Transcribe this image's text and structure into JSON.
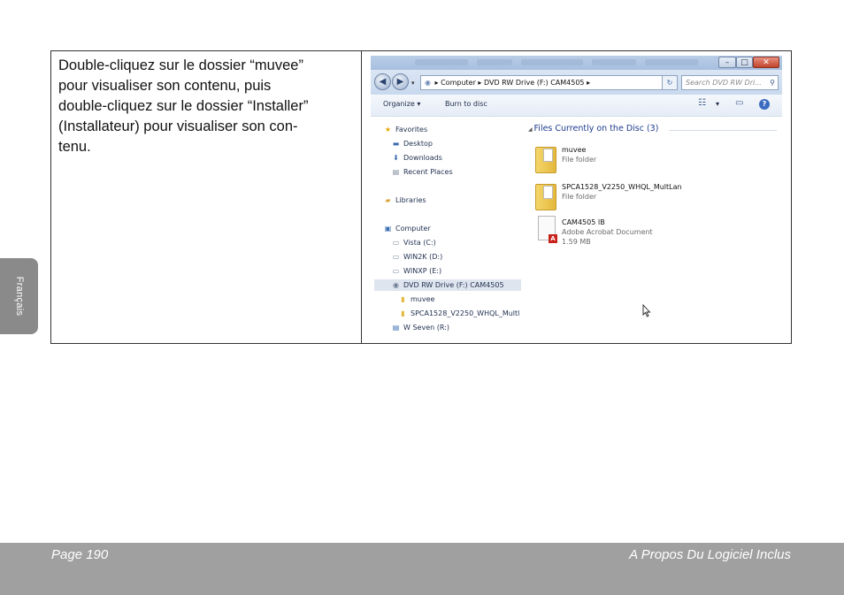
{
  "instruction": {
    "lines": [
      "Double-cliquez sur le dossier “muvee”",
      "pour visualiser son contenu, puis",
      "double-cliquez sur le dossier “Installer”",
      "(Installateur) pour visualiser son con-",
      "tenu."
    ]
  },
  "side_tab": {
    "label": "Français"
  },
  "footer": {
    "page": "Page 190",
    "section": "A Propos Du Logiciel Inclus"
  },
  "explorer": {
    "breadcrumb": [
      "Computer",
      "DVD RW Drive (F:) CAM4505"
    ],
    "search_placeholder": "Search DVD RW Dri...",
    "toolbar": {
      "organize": "Organize ▾",
      "burn": "Burn to disc"
    },
    "nav": {
      "favorites": "Favorites",
      "desktop": "Desktop",
      "downloads": "Downloads",
      "recent": "Recent Places",
      "libraries": "Libraries",
      "computer": "Computer",
      "vista": "Vista (C:)",
      "win2k": "WIN2K (D:)",
      "winxp": "WINXP (E:)",
      "dvd": "DVD RW Drive (F:) CAM4505",
      "muvee": "muvee",
      "spca": "SPCA1528_V2250_WHQL_Multl",
      "wseven": "W Seven (R:)"
    },
    "group_header": "Files Currently on the Disc (3)",
    "files": [
      {
        "name": "muvee",
        "type": "File folder",
        "size": ""
      },
      {
        "name": "SPCA1528_V2250_WHQL_MultLan",
        "type": "File folder",
        "size": ""
      },
      {
        "name": "CAM4505 IB",
        "type": "Adobe Acrobat Document",
        "size": "1.59 MB"
      }
    ]
  }
}
